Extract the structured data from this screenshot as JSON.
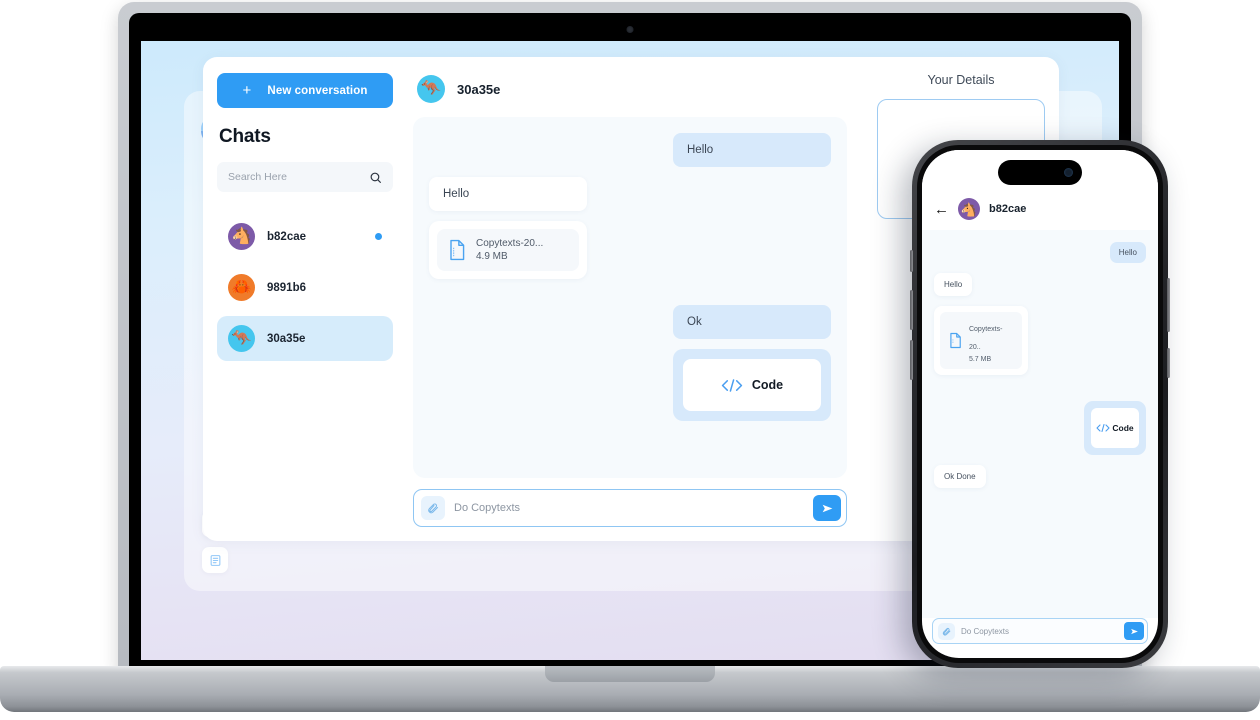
{
  "brand": {
    "accent": "#2f9cf4",
    "bubble_out": "#d7e9fb",
    "thread_bg": "#f6fafd",
    "active_row": "#d6ecfb"
  },
  "desktop": {
    "logo_name": "app-logo",
    "rail": {
      "dark_mode_icon": "moon-icon",
      "notes_icon": "document-icon"
    },
    "sidebar": {
      "new_conversation_label": "New conversation",
      "new_conversation_plus": "+",
      "heading": "Chats",
      "search_placeholder": "Search Here",
      "search_value": "",
      "search_icon": "search-icon",
      "chats": [
        {
          "name": "b82cae",
          "avatar": "horse",
          "unread": true,
          "active": false
        },
        {
          "name": "9891b6",
          "avatar": "crab",
          "unread": false,
          "active": false
        },
        {
          "name": "30a35e",
          "avatar": "roo",
          "unread": false,
          "active": true
        }
      ]
    },
    "conversation": {
      "title": "30a35e",
      "avatar": "roo",
      "messages": [
        {
          "type": "text",
          "side": "out",
          "text": "Hello"
        },
        {
          "type": "text",
          "side": "in",
          "text": "Hello"
        },
        {
          "type": "file",
          "side": "in",
          "file_name": "Copytexts-20...",
          "file_size": "4.9 MB"
        },
        {
          "type": "text",
          "side": "out",
          "text": "Ok"
        },
        {
          "type": "code",
          "side": "out",
          "label": "Code"
        }
      ],
      "composer": {
        "placeholder": "Do Copytexts",
        "value": "",
        "attach_icon": "paperclip-icon",
        "send_icon": "send-icon"
      }
    },
    "details": {
      "title": "Your Details"
    }
  },
  "phone": {
    "back_icon": "back-arrow-icon",
    "title": "b82cae",
    "avatar": "horse",
    "messages": [
      {
        "type": "text",
        "side": "out",
        "text": "Hello"
      },
      {
        "type": "text",
        "side": "in",
        "text": "Hello"
      },
      {
        "type": "file",
        "side": "in",
        "file_name": "Copytexts-20..",
        "file_size": "5.7 MB"
      },
      {
        "type": "code",
        "side": "out",
        "label": "Code"
      },
      {
        "type": "text",
        "side": "in",
        "text": "Ok Done"
      }
    ],
    "composer": {
      "placeholder": "Do Copytexts",
      "value": "",
      "attach_icon": "paperclip-icon",
      "send_icon": "send-icon"
    }
  }
}
